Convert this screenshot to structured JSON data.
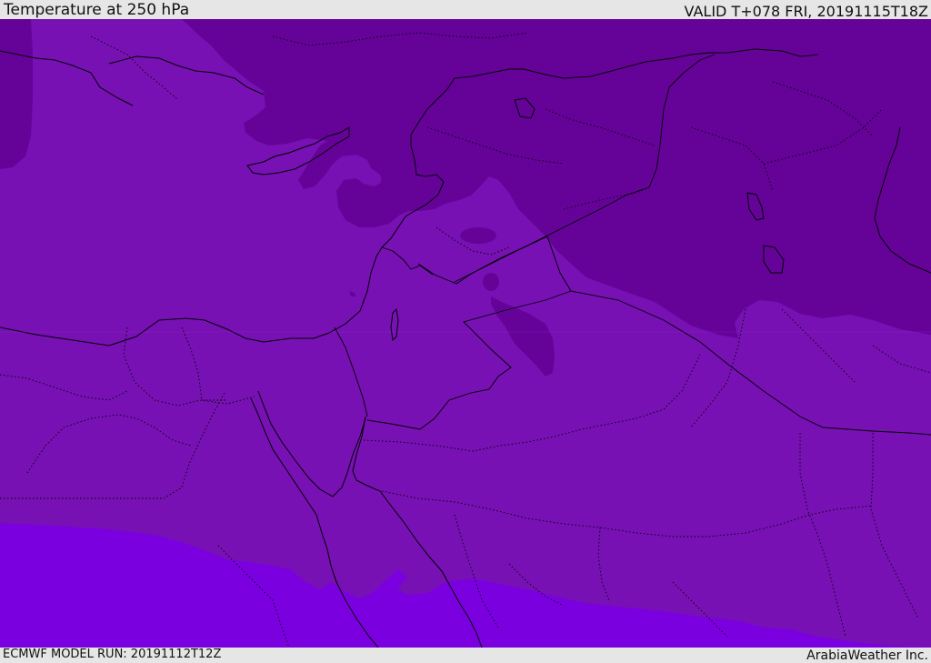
{
  "header": {
    "title": "Temperature at 250 hPa",
    "valid_time": "VALID T+078 FRI, 20191115T18Z"
  },
  "footer": {
    "model_run": "ECMWF MODEL RUN: 20191112T12Z",
    "credit": "ArabiaWeather Inc."
  },
  "map": {
    "field": "Temperature at 250 hPa",
    "colors": {
      "background_band": "#7711b3",
      "cold_band": "#650399",
      "warm_band": "#7b00e0",
      "lines": "#000000"
    }
  }
}
